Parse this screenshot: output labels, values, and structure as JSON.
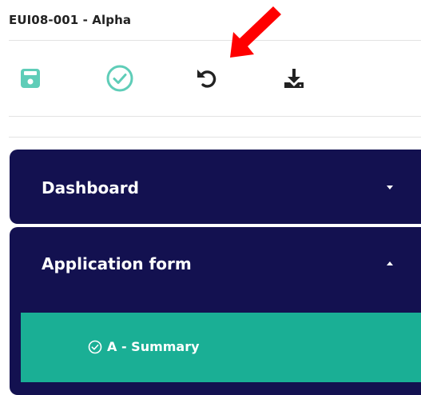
{
  "app": {
    "title": "EUI08-001 - Alpha"
  },
  "toolbar": {
    "items": [
      {
        "name": "save",
        "icon": "floppy-disk-icon",
        "color": "#5fcdb8"
      },
      {
        "name": "check",
        "icon": "circle-check-icon",
        "color": "#5fcdb8"
      },
      {
        "name": "reset",
        "icon": "undo-icon",
        "color": "#222222"
      },
      {
        "name": "export",
        "icon": "download-icon",
        "color": "#222222"
      }
    ]
  },
  "annotation": {
    "icon": "red-arrow-icon",
    "color": "#ff0000"
  },
  "nav": {
    "background": "#131150",
    "sections": [
      {
        "label": "Dashboard",
        "expanded": false,
        "caret": "chevron-down-icon"
      },
      {
        "label": "Application form",
        "expanded": true,
        "caret": "chevron-up-icon"
      }
    ],
    "subitems": [
      {
        "label": "A - Summary",
        "icon": "circle-check-icon",
        "active": true,
        "color": "#1aaf95"
      }
    ]
  }
}
